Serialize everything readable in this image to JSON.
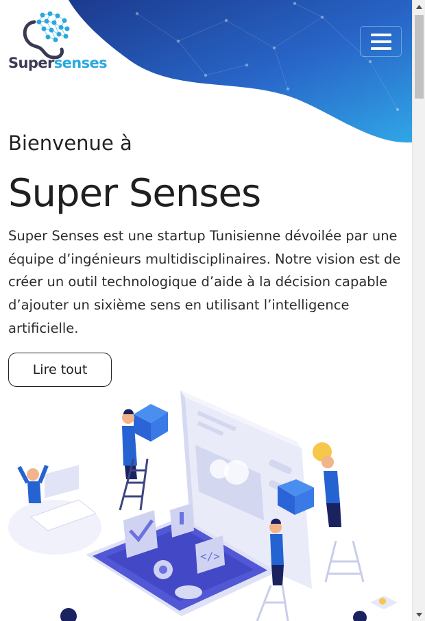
{
  "brand": {
    "logo_part1": "Super",
    "logo_part2": "senses",
    "accent_color": "#29a8e0",
    "dark_color": "#3a3a55",
    "header_gradient": [
      "#1e3c8c",
      "#2a6fd0",
      "#2fa5e8"
    ]
  },
  "header": {
    "menu_icon": "hamburger-icon"
  },
  "hero": {
    "welcome": "Bienvenue à",
    "title": "Super Senses",
    "description": "Super Senses est une startup Tunisienne dévoilée par une équipe d’ingénieurs multidisciplinaires. Notre vision est de créer un outil technologique d’aide à la décision capable d’ajouter un sixième sens en utilisant l’intelligence artificielle.",
    "read_more": "Lire tout"
  },
  "illustration": {
    "icon": "team-dashboard-isometric-illustration"
  }
}
